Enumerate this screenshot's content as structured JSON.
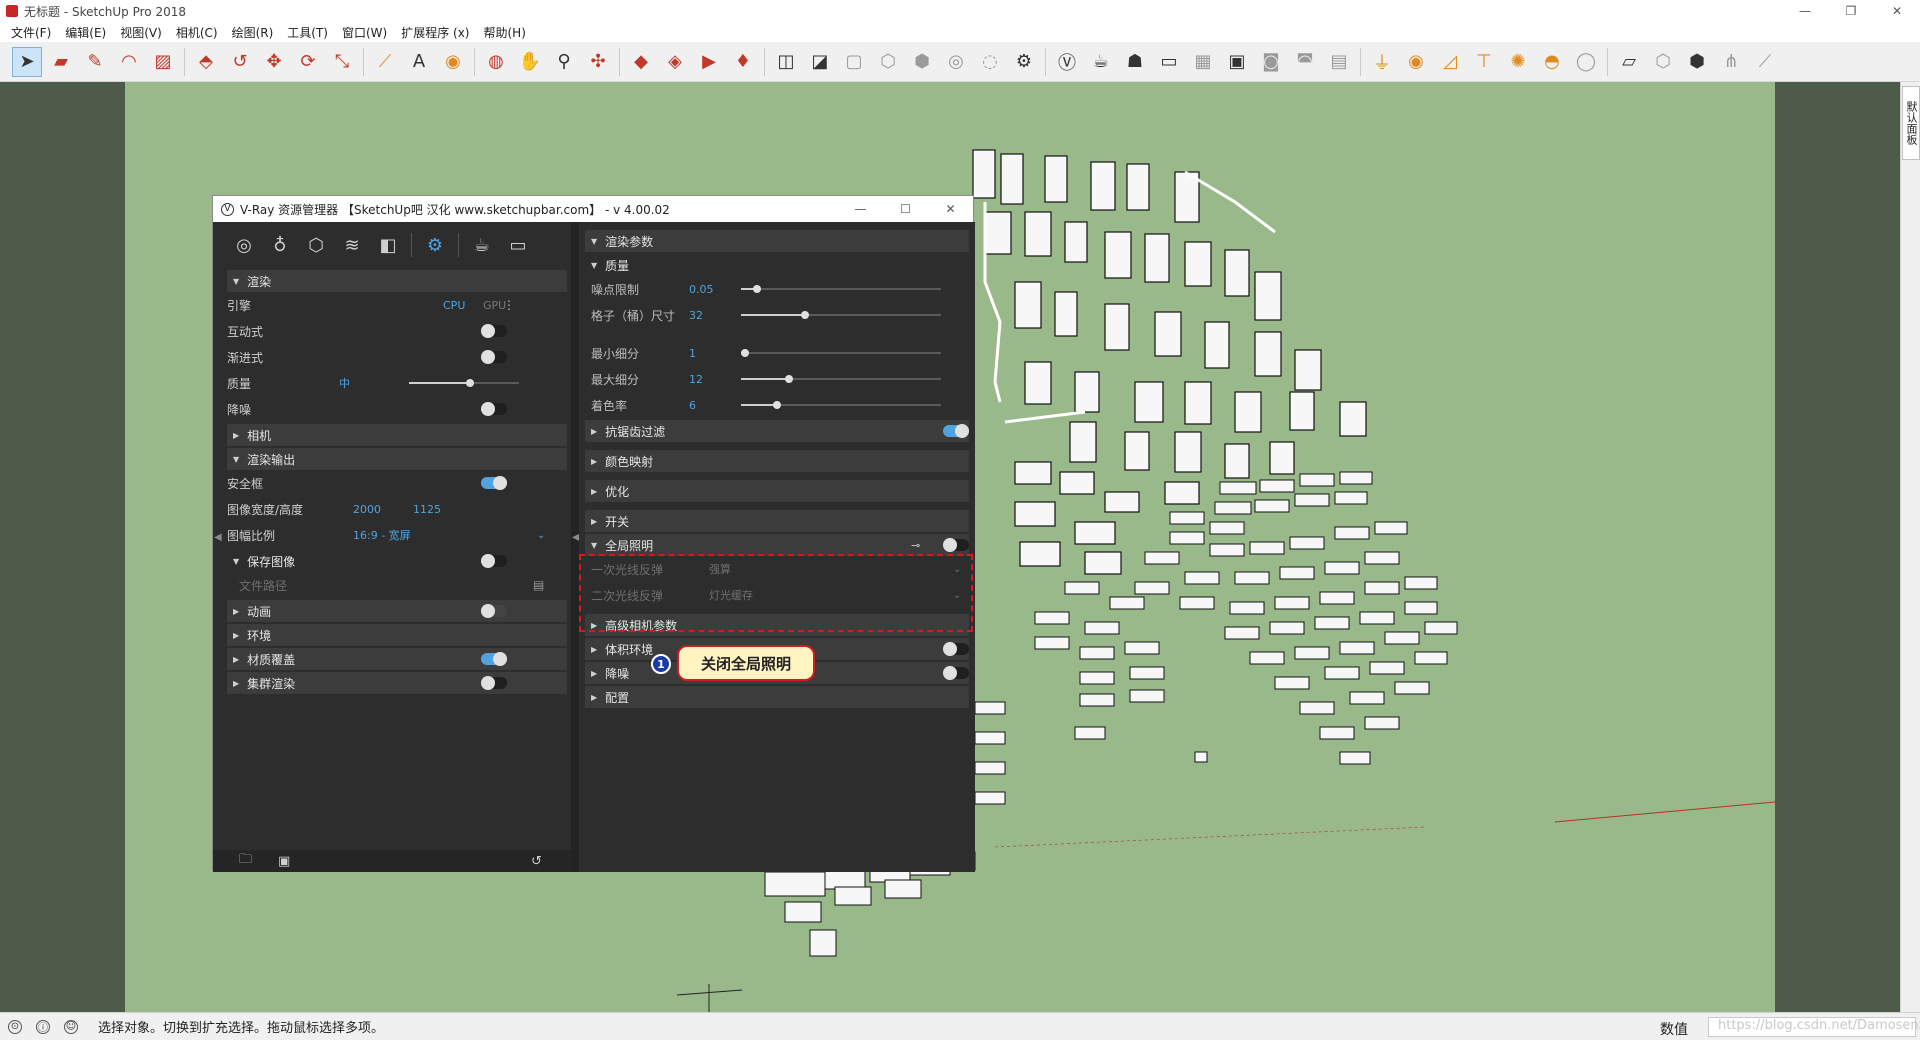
{
  "window": {
    "title": "无标题 - SketchUp Pro 2018",
    "minimize": "—",
    "maximize": "❐",
    "close": "✕"
  },
  "menu": [
    "文件(F)",
    "编辑(E)",
    "视图(V)",
    "相机(C)",
    "绘图(R)",
    "工具(T)",
    "窗口(W)",
    "扩展程序 (x)",
    "帮助(H)"
  ],
  "tray": {
    "tab_label": "默认面板"
  },
  "status": {
    "message": "选择对象。切换到扩充选择。拖动鼠标选择多项。",
    "measure_label": "数值",
    "watermark": "https://blog.csdn.net/Damosenzi"
  },
  "vray": {
    "title": "V-Ray 资源管理器 【SketchUp吧 汉化 www.sketchupbar.com】 - v 4.00.02",
    "left": {
      "render_section": "渲染",
      "engine_label": "引擎",
      "engine_cpu": "CPU",
      "engine_gpu": "GPU",
      "interactive_label": "互动式",
      "progressive_label": "渐进式",
      "quality_label": "质量",
      "quality_value": "中",
      "quality_level": 0.55,
      "denoise_label": "降噪",
      "camera_section": "相机",
      "output_section": "渲染输出",
      "safe_frame_label": "安全框",
      "image_size_label": "图像宽度/高度",
      "image_width": "2000",
      "image_height": "1125",
      "aspect_label": "图幅比例",
      "aspect_value": "16:9 - 宽屏",
      "save_image_section": "保存图像",
      "file_path_label": "文件路径",
      "animation_section": "动画",
      "environment_section": "环境",
      "material_override_section": "材质覆盖",
      "swarm_section": "集群渲染"
    },
    "right": {
      "render_params_section": "渲染参数",
      "quality_section": "质量",
      "noise_limit_label": "噪点限制",
      "noise_limit_value": "0.05",
      "noise_limit_level": 0.08,
      "bucket_size_label": "格子（桶）尺寸",
      "bucket_size_value": "32",
      "bucket_size_level": 0.32,
      "min_subdiv_label": "最小细分",
      "min_subdiv_value": "1",
      "min_subdiv_level": 0.02,
      "max_subdiv_label": "最大细分",
      "max_subdiv_value": "12",
      "max_subdiv_level": 0.24,
      "shading_rate_label": "着色率",
      "shading_rate_value": "6",
      "shading_rate_level": 0.18,
      "antialias_section": "抗锯齿过滤",
      "color_mapping_section": "颜色映射",
      "optimization_section": "优化",
      "switches_section": "开关",
      "gi_section": "全局照明",
      "primary_bounce_label": "一次光线反弹",
      "primary_bounce_value": "强算",
      "secondary_bounce_label": "二次光线反弹",
      "secondary_bounce_value": "灯光缓存",
      "advanced_camera_section": "高级相机参数",
      "volumetric_section": "体积环境",
      "denoise_section": "降噪",
      "config_section": "配置"
    },
    "callout": {
      "number": "1",
      "text": "关闭全局照明"
    }
  },
  "colors": {
    "accent": "#4fa3e0",
    "highlight_border": "#d01c1c",
    "callout_bg": "#fff4c2",
    "viewport_bg": "#9ab98a"
  }
}
